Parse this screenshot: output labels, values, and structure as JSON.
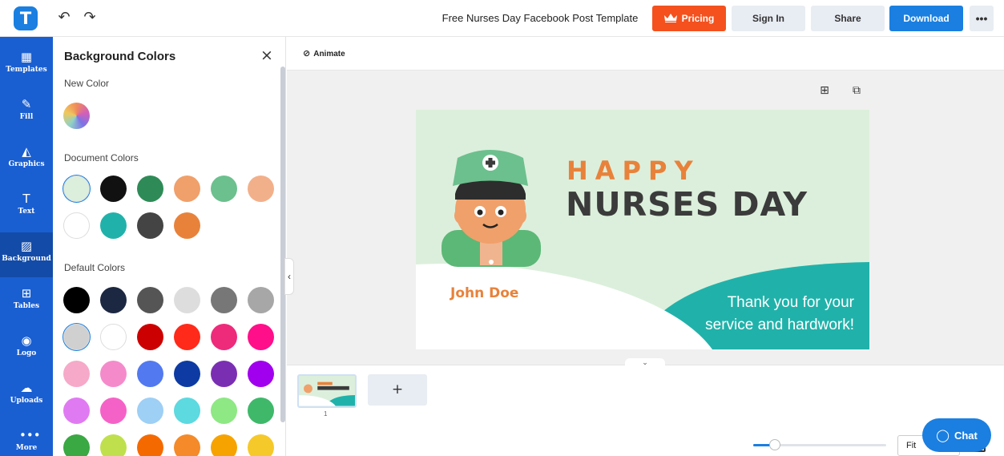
{
  "app": {
    "logo_letter": "T",
    "doc_title": "Free Nurses Day Facebook Post Template",
    "undo_glyph": "↶",
    "redo_glyph": "↷"
  },
  "topbar": {
    "pricing": "Pricing",
    "signin": "Sign In",
    "share": "Share",
    "download": "Download",
    "more": "•••"
  },
  "rail": [
    {
      "label": "Templates",
      "icon": "templates-icon",
      "glyph": "▦"
    },
    {
      "label": "Fill",
      "icon": "pencil-icon",
      "glyph": "✎"
    },
    {
      "label": "Graphics",
      "icon": "shapes-icon",
      "glyph": "◭"
    },
    {
      "label": "Text",
      "icon": "text-icon",
      "glyph": "T"
    },
    {
      "label": "Background",
      "icon": "background-icon",
      "glyph": "▨"
    },
    {
      "label": "Tables",
      "icon": "table-icon",
      "glyph": "⊞"
    },
    {
      "label": "Logo",
      "icon": "logo-icon",
      "glyph": "◉"
    },
    {
      "label": "Uploads",
      "icon": "upload-icon",
      "glyph": "☁"
    },
    {
      "label": "More",
      "icon": "more-icon",
      "glyph": "•••"
    }
  ],
  "panel": {
    "title": "Background Colors",
    "close": "×",
    "new_color_label": "New Color",
    "document_colors_label": "Document Colors",
    "default_colors_label": "Default Colors",
    "document_colors": [
      "#dcefdc",
      "#111111",
      "#2e8b57",
      "#f0a06a",
      "#6cc08e",
      "#f2b08a",
      "#ffffff",
      "#20b2aa",
      "#444444",
      "#e8823b"
    ],
    "default_colors": [
      "#000000",
      "#1c2741",
      "#555555",
      "#dddddd",
      "#777777",
      "#a7a7a7",
      "#d0d0d0",
      "#ffffff",
      "#cc0000",
      "#ff2a1a",
      "#ee2a7b",
      "#ff0f8a",
      "#f6a9c8",
      "#f58acb",
      "#5279f0",
      "#0d3ba3",
      "#7a2fb3",
      "#a000ee",
      "#e07af2",
      "#f562c7",
      "#9ecff5",
      "#5dd9e0",
      "#8ee884",
      "#3fb86a",
      "#3aa843",
      "#bfe04c",
      "#f56a00",
      "#f48a29",
      "#f6a300",
      "#f6c92a"
    ]
  },
  "editor": {
    "animate": "Animate",
    "animate_icon": "animate-icon",
    "collapse_glyph": "‹",
    "add_page": "+",
    "page_number": "1",
    "zoom_fraction": 0.16,
    "fit_label": "Fit",
    "chat": "Chat",
    "drawer_glyph": "⌄"
  },
  "design": {
    "happy": "HAPPY",
    "nurses_day": "NURSES DAY",
    "name": "John Doe",
    "thanks_line1": "Thank you for your",
    "thanks_line2": "service and hardwork!",
    "colors": {
      "bg": "#dcefdc",
      "accent": "#e8823b",
      "teal": "#20b2aa",
      "dark": "#3b3b3b"
    }
  }
}
